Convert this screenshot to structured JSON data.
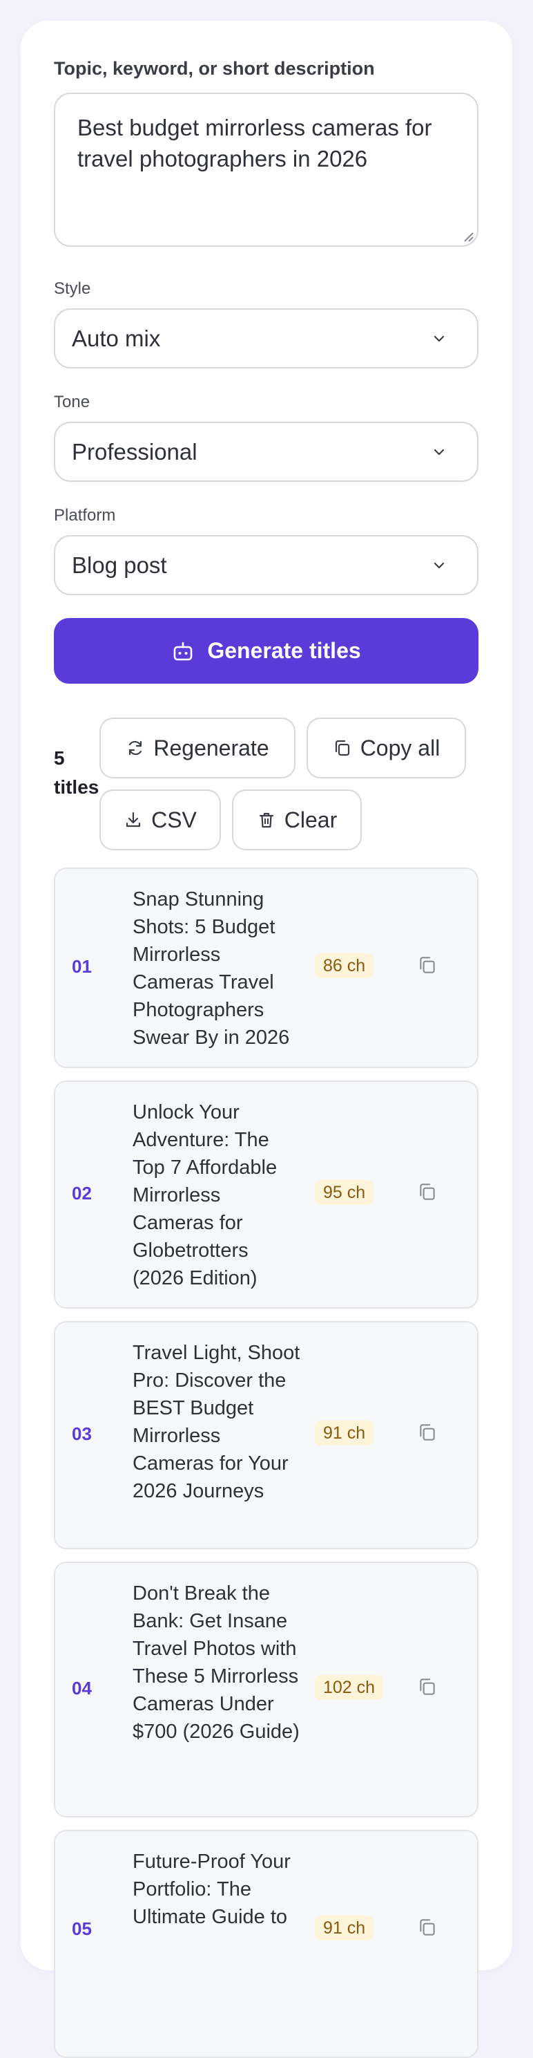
{
  "form": {
    "topic_label": "Topic, keyword, or short description",
    "topic_value": "Best budget mirrorless cameras for travel photographers in 2026",
    "style_label": "Style",
    "style_value": "Auto mix",
    "tone_label": "Tone",
    "tone_value": "Professional",
    "platform_label": "Platform",
    "platform_value": "Blog post",
    "generate_label": "Generate titles"
  },
  "results": {
    "count_label": "5 titles",
    "regenerate_label": "Regenerate",
    "copy_all_label": "Copy all",
    "csv_label": "CSV",
    "clear_label": "Clear",
    "items": [
      {
        "num": "01",
        "title": "Snap Stunning Shots: 5 Budget Mirrorless Cameras Travel Photographers Swear By in 2026",
        "chars": "86 ch"
      },
      {
        "num": "02",
        "title": "Unlock Your Adventure: The Top 7 Affordable Mirrorless Cameras for Globetrotters (2026 Edition)",
        "chars": "95 ch"
      },
      {
        "num": "03",
        "title": "Travel Light, Shoot Pro: Discover the BEST Budget Mirrorless Cameras for Your 2026 Journeys",
        "chars": "91 ch"
      },
      {
        "num": "04",
        "title": "Don't Break the Bank: Get Insane Travel Photos with These 5 Mirrorless Cameras Under $700 (2026 Guide)",
        "chars": "102 ch"
      },
      {
        "num": "05",
        "title": "Future-Proof Your Portfolio: The Ultimate Guide to",
        "chars": "91 ch"
      }
    ]
  },
  "icons": {
    "generate": "robot-icon",
    "regenerate": "refresh-icon",
    "copy": "copy-icon",
    "csv": "download-icon",
    "clear": "trash-icon",
    "select": "chevron-down-icon"
  },
  "colors": {
    "accent": "#5a3bd9",
    "char_badge_bg": "#fdf4d9",
    "char_badge_text": "#8a5a10",
    "page_bg": "#f3f2fc"
  }
}
